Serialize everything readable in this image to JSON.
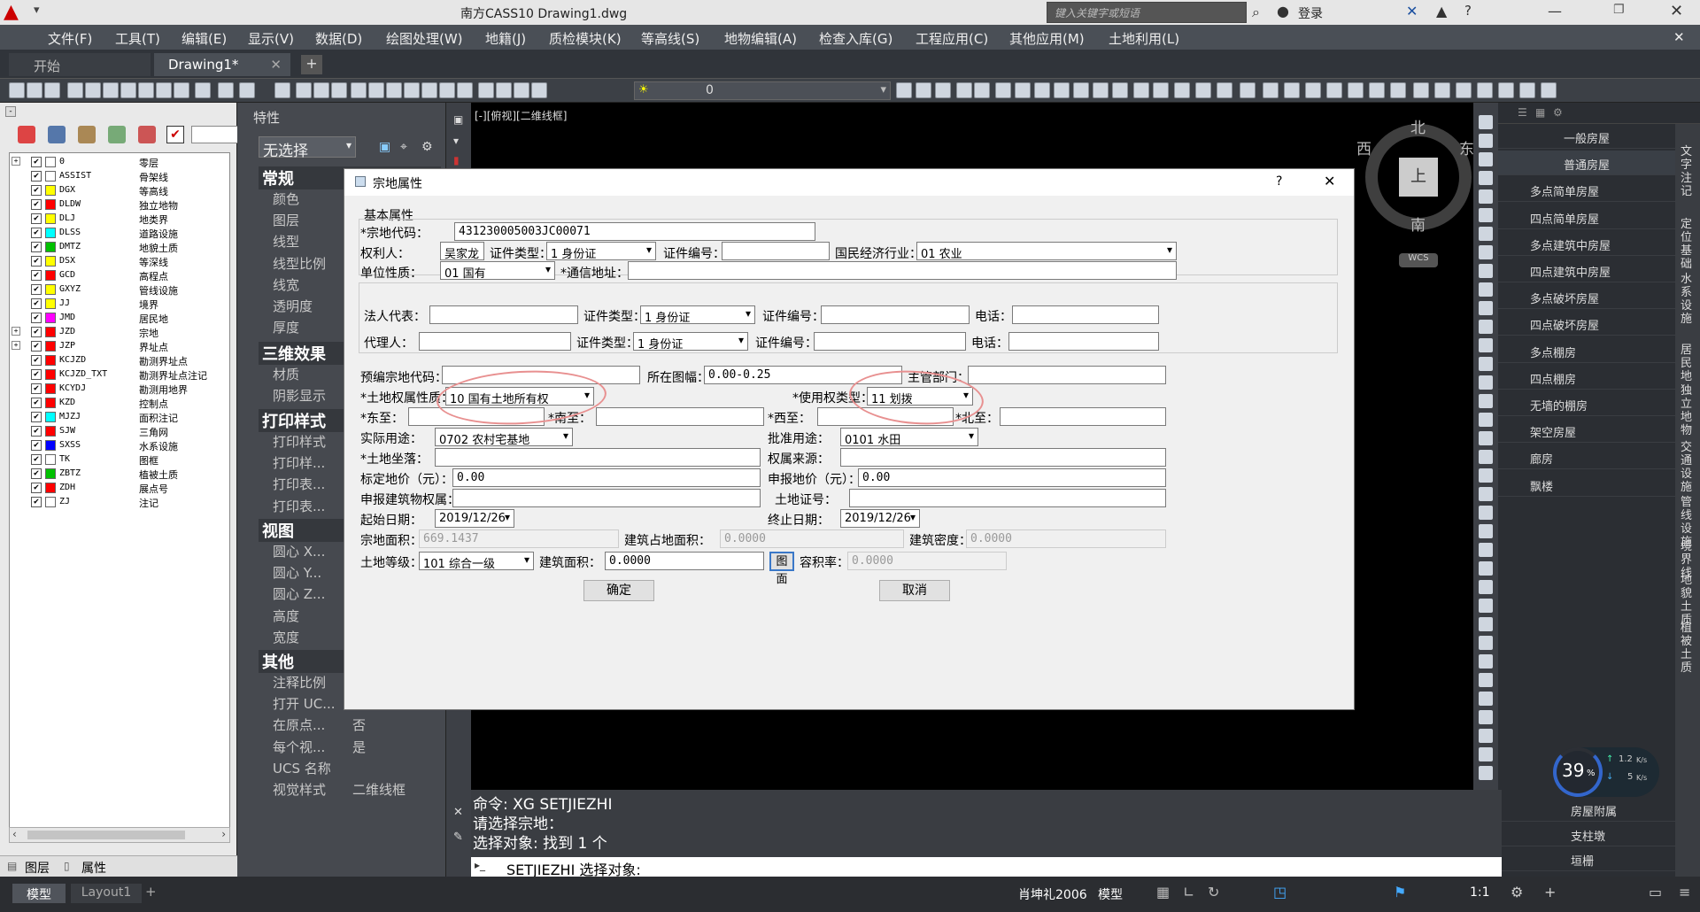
{
  "app": {
    "title": "南方CASS10  Drawing1.dwg",
    "search_placeholder": "键入关键字或短语",
    "login": "登录"
  },
  "menu": [
    "文件(F)",
    "工具(T)",
    "编辑(E)",
    "显示(V)",
    "数据(D)",
    "绘图处理(W)",
    "地籍(J)",
    "质检模块(K)",
    "等高线(S)",
    "地物编辑(A)",
    "检查入库(G)",
    "工程应用(C)",
    "其他应用(M)",
    "土地利用(L)"
  ],
  "tabs": {
    "start": "开始",
    "drawing": "Drawing1*",
    "plus": "+"
  },
  "toolbar": {
    "layer_value": "0"
  },
  "layers": [
    {
      "name": "0",
      "desc": "零层",
      "color": "#ffffff"
    },
    {
      "name": "ASSIST",
      "desc": "骨架线",
      "color": "#ffffff"
    },
    {
      "name": "DGX",
      "desc": "等高线",
      "color": "#ffff00"
    },
    {
      "name": "DLDW",
      "desc": "独立地物",
      "color": "#ff0000"
    },
    {
      "name": "DLJ",
      "desc": "地类界",
      "color": "#ffff00"
    },
    {
      "name": "DLSS",
      "desc": "道路设施",
      "color": "#00ffff"
    },
    {
      "name": "DMTZ",
      "desc": "地貌土质",
      "color": "#00c000"
    },
    {
      "name": "DSX",
      "desc": "等深线",
      "color": "#ffff00"
    },
    {
      "name": "GCD",
      "desc": "高程点",
      "color": "#ff0000"
    },
    {
      "name": "GXYZ",
      "desc": "管线设施",
      "color": "#ffff00"
    },
    {
      "name": "JJ",
      "desc": "境界",
      "color": "#ffff00"
    },
    {
      "name": "JMD",
      "desc": "居民地",
      "color": "#ff00ff"
    },
    {
      "name": "JZD",
      "desc": "宗地",
      "color": "#ff0000"
    },
    {
      "name": "JZP",
      "desc": "界址点",
      "color": "#ff0000"
    },
    {
      "name": "KCJZD",
      "desc": "勘测界址点",
      "color": "#ff0000"
    },
    {
      "name": "KCJZD_TXT",
      "desc": "勘测界址点注记",
      "color": "#ff0000"
    },
    {
      "name": "KCYDJ",
      "desc": "勘测用地界",
      "color": "#ff0000"
    },
    {
      "name": "KZD",
      "desc": "控制点",
      "color": "#ff0000"
    },
    {
      "name": "MJZJ",
      "desc": "面积注记",
      "color": "#00ffff"
    },
    {
      "name": "SJW",
      "desc": "三角网",
      "color": "#ff0000"
    },
    {
      "name": "SXSS",
      "desc": "水系设施",
      "color": "#0000ff"
    },
    {
      "name": "TK",
      "desc": "图框",
      "color": "#ffffff"
    },
    {
      "name": "ZBTZ",
      "desc": "植被土质",
      "color": "#00c000"
    },
    {
      "name": "ZDH",
      "desc": "展点号",
      "color": "#ff0000"
    },
    {
      "name": "ZJ",
      "desc": "注记",
      "color": "#ffffff"
    }
  ],
  "leftbottom": {
    "layers_tab": "图层",
    "props_tab": "属性"
  },
  "props": {
    "title": "特性",
    "selection": "无选择",
    "sec_general": "常规",
    "general": [
      "颜色",
      "图层",
      "线型",
      "线型比例",
      "线宽",
      "透明度",
      "厚度"
    ],
    "sec_3d": "三维效果",
    "three_d": [
      "材质",
      "阴影显示"
    ],
    "sec_print": "打印样式",
    "print": [
      "打印样式",
      "打印样...",
      "打印表...",
      "打印表..."
    ],
    "sec_view": "视图",
    "view": [
      "圆心 X...",
      "圆心 Y...",
      "圆心 Z...",
      "高度",
      "宽度"
    ],
    "sec_other": "其他",
    "other": [
      "注释比例",
      "打开 UC...",
      "在原点...",
      "每个视...",
      "UCS 名称",
      "视觉样式"
    ],
    "other_vals": [
      "",
      "",
      "否",
      "是",
      "",
      "二维线框"
    ]
  },
  "canvas": {
    "viewlabel": "[-][俯视][二维线框]",
    "north": "北",
    "south": "南",
    "east": "东",
    "west": "西",
    "top": "上",
    "wcs": "WCS"
  },
  "dialog": {
    "title": "宗地属性",
    "help": "?",
    "close": "✕",
    "group_basic": "基本属性",
    "zd_code_label": "*宗地代码：",
    "zd_code": "431230005003JC00071",
    "owner_label": "权利人：",
    "owner": "吴家龙",
    "cert_type_label": "证件类型：",
    "cert_type": "1 身份证",
    "cert_no_label": "证件编号：",
    "cert_no": "",
    "industry_label": "国民经济行业：",
    "industry": "01 农业",
    "unit_label": "单位性质：",
    "unit": "01 国有",
    "addr_label": "*通信地址：",
    "addr": "",
    "legal_label": "法人代表：",
    "legal_cert_label": "证件类型：",
    "legal_cert": "1 身份证",
    "legal_no_label": "证件编号：",
    "legal_phone_label": "电话：",
    "agent_label": "代理人：",
    "agent_cert_label": "证件类型：",
    "agent_cert": "1 身份证",
    "agent_no_label": "证件编号：",
    "agent_phone_label": "电话：",
    "pre_code_label": "预编宗地代码：",
    "sheet_label": "所在图幅：",
    "sheet": "0.00-0.25",
    "dept_label": "主管部门：",
    "right_nature_label": "*土地权属性质：",
    "right_nature": "10 国有土地所有权",
    "use_type_label": "*使用权类型：",
    "use_type": "11 划拨",
    "east_label": "*东至：",
    "south_label": "*南至：",
    "west_label": "*西至：",
    "north_label": "*北至：",
    "actual_use_label": "实际用途：",
    "actual_use": "0702 农村宅基地",
    "approved_use_label": "批准用途：",
    "approved_use": "0101 水田",
    "location_label": "*土地坐落：",
    "source_label": "权属来源：",
    "std_price_label": "标定地价（元）：",
    "std_price": "0.00",
    "decl_price_label": "申报地价（元）：",
    "decl_price": "0.00",
    "decl_build_label": "申报建筑物权属：",
    "land_cert_label": "土地证号：",
    "start_label": "起始日期：",
    "start": "2019/12/26",
    "end_label": "终止日期：",
    "end": "2019/12/26",
    "area_label": "宗地面积：",
    "area": "669.1437",
    "build_occ_label": "建筑占地面积：",
    "build_occ": "0.0000",
    "density_label": "建筑密度：",
    "density": "0.0000",
    "grade_label": "土地等级：",
    "grade": "101 综合一级",
    "build_area_label": "建筑面积：",
    "build_area": "0.0000",
    "pic_btn": "图面",
    "far_label": "容积率：",
    "far": "0.0000",
    "ok": "确定",
    "cancel": "取消"
  },
  "right_panel": {
    "items": [
      "一般房屋",
      "普通房屋",
      "多点简单房屋",
      "四点简单房屋",
      "多点建筑中房屋",
      "四点建筑中房屋",
      "多点破坏房屋",
      "四点破坏房屋",
      "多点棚房",
      "四点棚房",
      "无墙的棚房",
      "架空房屋",
      "廊房",
      "飘楼"
    ],
    "bottom": [
      "房屋附属",
      "支柱墩",
      "垣栅"
    ],
    "vtabs": [
      "文字注记",
      "定位基础",
      "水系设施",
      "居民地",
      "独立地物",
      "交通设施",
      "管线设施",
      "境界线",
      "地貌土质",
      "植被土质"
    ]
  },
  "cmd": {
    "line1": "命令: XG SETJIEZHI",
    "line2": "请选择宗地：",
    "line3": "选择对象: 找到 1 个",
    "prompt": "SETJIEZHI 选择对象:"
  },
  "status": {
    "model": "模型",
    "layout1": "Layout1",
    "user": "肖坤礼2006",
    "model_btn": "模型",
    "scale": "1:1"
  },
  "netmeter": {
    "percent": "39",
    "unit": "%",
    "up": "1.2",
    "up_unit": "K/s",
    "down": "5",
    "down_unit": "K/s"
  }
}
